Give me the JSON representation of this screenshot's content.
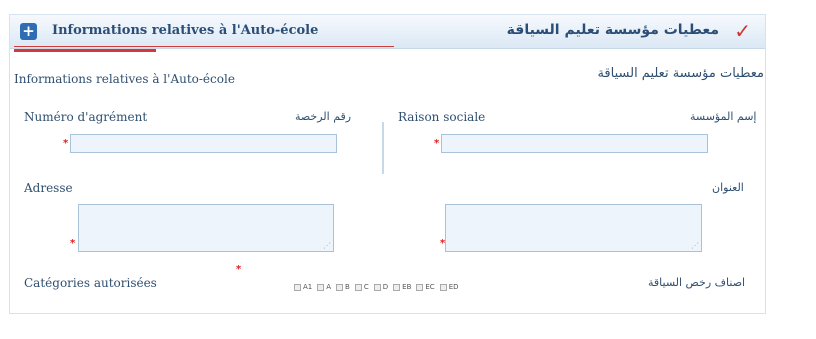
{
  "header": {
    "title_fr": "Informations relatives à l'Auto-école",
    "title_ar": "معطيات مؤسسة تعليم السياقة",
    "plus_symbol": "+",
    "check_symbol": "✓"
  },
  "section": {
    "subtitle_fr": "Informations relatives à l'Auto-école",
    "subtitle_ar": "معطيات مؤسسة تعليم السياقة"
  },
  "fields": {
    "numero_agrement": {
      "label_fr": "Numéro d'agrément",
      "label_ar": "رقم الرخصة",
      "value": ""
    },
    "raison_sociale": {
      "label_fr": "Raison sociale",
      "label_ar": "إسم المؤسسة",
      "value": ""
    },
    "adresse": {
      "label_fr": "Adresse",
      "label_ar": "العنوان",
      "value_fr": "",
      "value_ar": ""
    },
    "categories": {
      "label_fr": "Catégories autorisées",
      "label_ar": "اصناف رخص السياقة"
    }
  },
  "required_marker": "*",
  "resize_glyph": "⋰",
  "categories": [
    "A1",
    "A",
    "B",
    "C",
    "D",
    "EB",
    "EC",
    "ED"
  ]
}
